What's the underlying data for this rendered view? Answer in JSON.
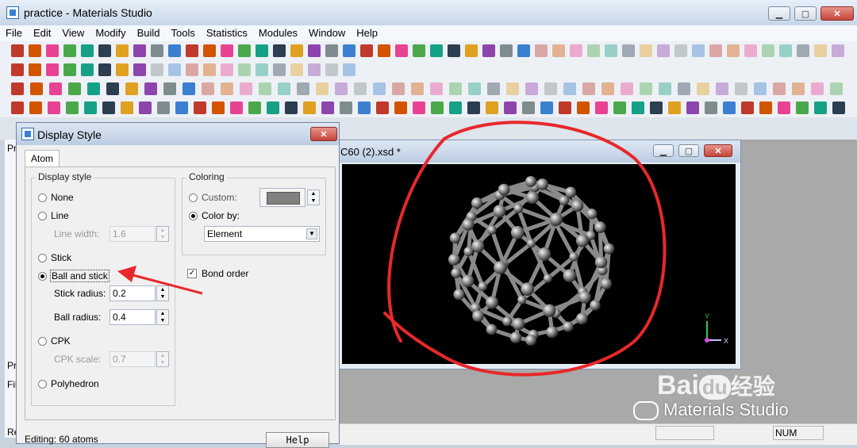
{
  "window": {
    "title": "practice - Materials Studio",
    "minimize": "▁",
    "maximize": "▢",
    "close": "✕"
  },
  "menu": [
    "File",
    "Edit",
    "View",
    "Modify",
    "Build",
    "Tools",
    "Statistics",
    "Modules",
    "Window",
    "Help"
  ],
  "dialog": {
    "title": "Display Style",
    "close": "✕",
    "tab": "Atom",
    "display_style_label": "Display style",
    "options": [
      "None",
      "Line",
      "Stick",
      "Ball and stick",
      "CPK",
      "Polyhedron"
    ],
    "selected": "Ball and stick",
    "line_width_label": "Line width:",
    "line_width": "1.6",
    "stick_radius_label": "Stick radius:",
    "stick_radius": "0.2",
    "ball_radius_label": "Ball radius:",
    "ball_radius": "0.4",
    "cpk_scale_label": "CPK scale:",
    "cpk_scale": "0.7",
    "coloring_label": "Coloring",
    "custom_label": "Custom:",
    "color_by_label": "Color by:",
    "color_by_value": "Element",
    "bond_order_label": "Bond order",
    "bond_order_checked": true,
    "help_label": "Help"
  },
  "viewer": {
    "title": "C60 (2).xsd *",
    "axis_y": "Y",
    "axis_x": "X"
  },
  "status": {
    "editing": "Editing: 60 atoms",
    "num": "NUM"
  },
  "left_panel": {
    "p1": "Pr",
    "p2": "Pr",
    "fi": "Fil",
    "re": "Re"
  },
  "watermark": {
    "brand": "Bai",
    "du": "du",
    "cn": "经验",
    "sub": "Materials Studio"
  },
  "colors": {
    "annotation": "#e8282b",
    "viewport_bg": "#000000",
    "title_gradient": "#c7d6e7"
  }
}
